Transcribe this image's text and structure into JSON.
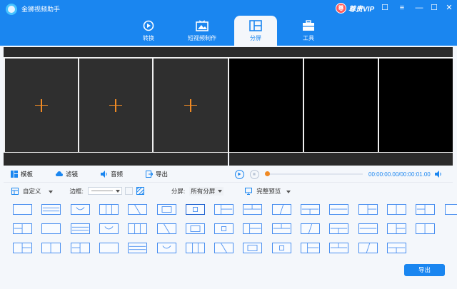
{
  "app": {
    "title": "金狮视频助手"
  },
  "vip": {
    "label": "尊贵VIP",
    "badge": "尊"
  },
  "window_controls": {
    "chat": "☐",
    "menu": "≡",
    "minimize": "—",
    "maximize": "☐",
    "close": "✕"
  },
  "nav": {
    "tabs": [
      {
        "label": "转换",
        "icon": "convert-icon"
      },
      {
        "label": "短视频制作",
        "icon": "video-maker-icon"
      },
      {
        "label": "分屏",
        "icon": "split-screen-icon",
        "active": true
      },
      {
        "label": "工具",
        "icon": "toolbox-icon"
      }
    ]
  },
  "editor": {
    "tabs": [
      {
        "label": "模板",
        "icon": "template-icon",
        "active": true
      },
      {
        "label": "滤镜",
        "icon": "cloud-icon"
      },
      {
        "label": "音频",
        "icon": "speaker-icon"
      },
      {
        "label": "导出",
        "icon": "export-icon"
      }
    ]
  },
  "player": {
    "time": "00:00:00.00/00:00:01.00",
    "progress": 0
  },
  "toolbar": {
    "custom_label": "自定义",
    "border_label": "边框:",
    "split_label": "分屏:",
    "split_value": "所有分屏",
    "preview_label": "完整预览"
  },
  "colors": {
    "accent": "#1a86f0",
    "orange": "#f08a24"
  },
  "templates": {
    "rows": [
      16,
      15,
      14
    ],
    "selected_index": 6
  },
  "export_button": {
    "label": "导出"
  }
}
